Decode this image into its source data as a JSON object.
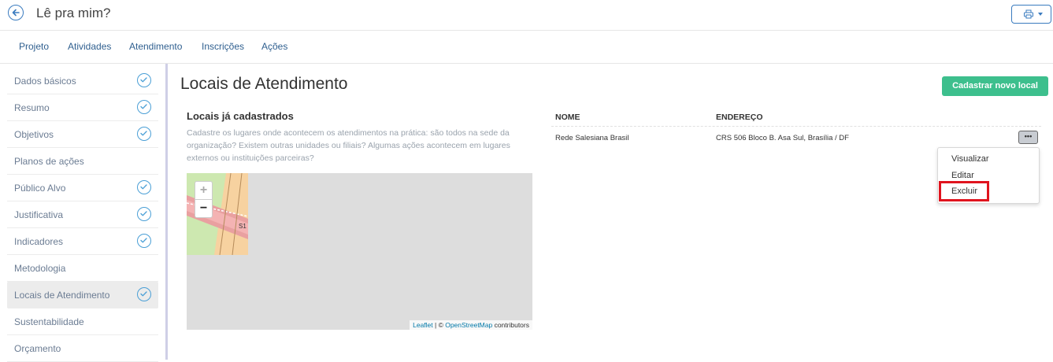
{
  "header": {
    "title": "Lê pra mim?"
  },
  "tabs": [
    "Projeto",
    "Atividades",
    "Atendimento",
    "Inscrições",
    "Ações"
  ],
  "sidebar": {
    "items": [
      {
        "label": "Dados básicos",
        "done": true
      },
      {
        "label": "Resumo",
        "done": true
      },
      {
        "label": "Objetivos",
        "done": true
      },
      {
        "label": "Planos de ações",
        "done": false
      },
      {
        "label": "Público Alvo",
        "done": true
      },
      {
        "label": "Justificativa",
        "done": true
      },
      {
        "label": "Indicadores",
        "done": true
      },
      {
        "label": "Metodologia",
        "done": false
      },
      {
        "label": "Locais de Atendimento",
        "done": true,
        "active": true
      },
      {
        "label": "Sustentabilidade",
        "done": false
      },
      {
        "label": "Orçamento",
        "done": false
      }
    ]
  },
  "main": {
    "title": "Locais de Atendimento",
    "new_button": "Cadastrar novo local",
    "section_title": "Locais já cadastrados",
    "description": "Cadastre os lugares onde acontecem os atendimentos na prática: são todos na sede da organização? Existem outras unidades ou filiais? Algumas ações acontecem em lugares externos ou instituições parceiras?",
    "map": {
      "zoom_in": "+",
      "zoom_out": "−",
      "attribution_leaflet": "Leaflet",
      "attribution_sep": " | © ",
      "attribution_osm": "OpenStreetMap",
      "attribution_contrib": " contributors",
      "road_label": "S1"
    },
    "table": {
      "headers": {
        "name": "NOME",
        "address": "ENDEREÇO"
      },
      "rows": [
        {
          "name": "Rede Salesiana Brasil",
          "address": "CRS 506 Bloco B. Asa Sul, Brasília / DF",
          "actions": "•••"
        }
      ]
    },
    "row_menu": [
      "Visualizar",
      "Editar",
      "Excluir"
    ]
  },
  "colors": {
    "accent": "#3a7bbf",
    "primary_button": "#3dbf8d",
    "highlight": "#e0141e"
  }
}
